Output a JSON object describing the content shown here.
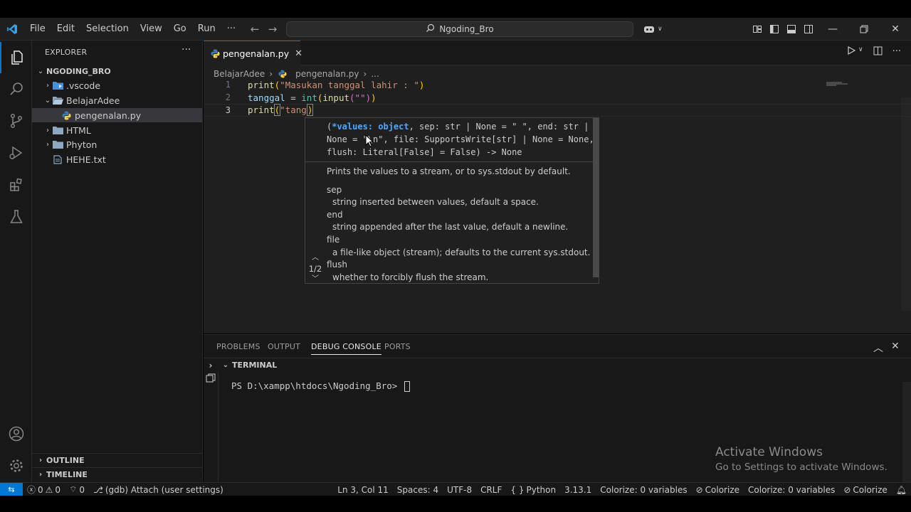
{
  "titlebar": {
    "menu": [
      "File",
      "Edit",
      "Selection",
      "View",
      "Go",
      "Run",
      "···"
    ],
    "search_text": "Ngoding_Bro"
  },
  "explorer": {
    "title": "EXPLORER",
    "more": "···",
    "root": "NGODING_BRO",
    "items": [
      {
        "label": ".vscode",
        "type": "folder-collapsed",
        "depth": 1
      },
      {
        "label": "BelajarAdee",
        "type": "folder-open",
        "depth": 1
      },
      {
        "label": "pengenalan.py",
        "type": "python-file",
        "depth": 2,
        "selected": true
      },
      {
        "label": "HTML",
        "type": "folder-collapsed",
        "depth": 1
      },
      {
        "label": "Phyton",
        "type": "folder-collapsed",
        "depth": 1
      },
      {
        "label": "HEHE.txt",
        "type": "text-file",
        "depth": 1
      }
    ],
    "outline": "OUTLINE",
    "timeline": "TIMELINE"
  },
  "editor": {
    "tab_label": "pengenalan.py",
    "tab_close": "✕",
    "breadcrumb": [
      "BelajarAdee",
      "pengenalan.py",
      "..."
    ],
    "line_numbers": [
      "1",
      "2",
      "3"
    ],
    "line1": {
      "fn": "print",
      "open": "(",
      "str": "\"Masukan tanggal lahir : \"",
      "close": ")"
    },
    "line2": {
      "var": "tanggal",
      "op": " = ",
      "typ": "int",
      "open": "(",
      "fn": "input",
      "inner": "(\"\")",
      "close": ")"
    },
    "line3": {
      "fn": "print",
      "open": "(",
      "str": "\"tang",
      "close": ")"
    }
  },
  "hover": {
    "sig_line1_a": "(",
    "sig_line1_b": "*values: object",
    "sig_line1_c": ", sep: str | None = \" \", end: str |",
    "sig_line2": "None = \"\\n\", file: SupportsWrite[str] | None = None,",
    "sig_line3": "flush: Literal[False] = False) -> None",
    "description": "Prints the values to a stream, or to sys.stdout by default.",
    "params": [
      {
        "name": "sep",
        "desc": "string inserted between values, default a space."
      },
      {
        "name": "end",
        "desc": "string appended after the last value, default a newline."
      },
      {
        "name": "file",
        "desc": "a file-like object (stream); defaults to the current sys.stdout."
      },
      {
        "name": "flush",
        "desc": "whether to forcibly flush the stream."
      }
    ],
    "pager": "1/2"
  },
  "panel": {
    "tabs": [
      "PROBLEMS",
      "OUTPUT",
      "DEBUG CONSOLE",
      "PORTS"
    ],
    "active_tab": "DEBUG CONSOLE",
    "terminal_header": "TERMINAL",
    "prompt": "PS D:\\xampp\\htdocs\\Ngoding_Bro> "
  },
  "watermark": {
    "line1": "Activate Windows",
    "line2": "Go to Settings to activate Windows."
  },
  "statusbar": {
    "errors": "0",
    "warnings": "0",
    "ports": "0",
    "debug": "(gdb) Attach (user settings)",
    "position": "Ln 3, Col 11",
    "spaces": "Spaces: 4",
    "encoding": "UTF-8",
    "eol": "CRLF",
    "language": "Python",
    "version": "3.13.1",
    "colorize_vars_1": "Colorize: 0 variables",
    "colorize_1": "Colorize",
    "colorize_vars_2": "Colorize: 0 variables",
    "colorize_2": "Colorize"
  },
  "colors": {
    "accent": "#0078d4",
    "background": "#1f1f1f",
    "sidebar": "#181818"
  }
}
